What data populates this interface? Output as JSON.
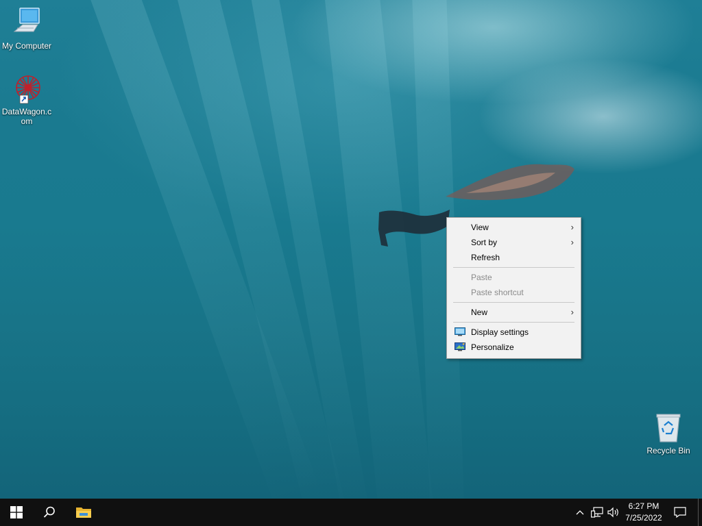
{
  "desktop": {
    "icons": [
      {
        "label": "My Computer",
        "icon": "computer-icon"
      },
      {
        "label": "DataWagon.com",
        "label_line1": "DataWagon.c",
        "label_line2": "om",
        "icon": "datawagon-shortcut-icon"
      },
      {
        "label": "Recycle Bin",
        "icon": "recycle-bin-icon"
      }
    ]
  },
  "context_menu": {
    "items": [
      {
        "label": "View",
        "submenu": true,
        "enabled": true
      },
      {
        "label": "Sort by",
        "submenu": true,
        "enabled": true
      },
      {
        "label": "Refresh",
        "submenu": false,
        "enabled": true
      },
      {
        "label": "Paste",
        "submenu": false,
        "enabled": false
      },
      {
        "label": "Paste shortcut",
        "submenu": false,
        "enabled": false
      },
      {
        "label": "New",
        "submenu": true,
        "enabled": true
      },
      {
        "label": "Display settings",
        "submenu": false,
        "enabled": true,
        "icon": "display-settings-icon"
      },
      {
        "label": "Personalize",
        "submenu": false,
        "enabled": true,
        "icon": "personalize-icon"
      }
    ],
    "submenu_arrow": "›"
  },
  "taskbar": {
    "buttons": [
      "start-windows-icon",
      "search-icon",
      "file-explorer-icon"
    ],
    "tray": [
      "show-hidden-icons-chevron",
      "network-icon",
      "volume-icon"
    ],
    "clock": {
      "time": "6:27 PM",
      "date": "7/25/2022"
    },
    "notifications": "action-center-icon"
  },
  "colors": {
    "taskbar": "#101010",
    "menu_bg": "#f2f2f2",
    "water": "#1a7a90",
    "accent": "#0078d7"
  }
}
